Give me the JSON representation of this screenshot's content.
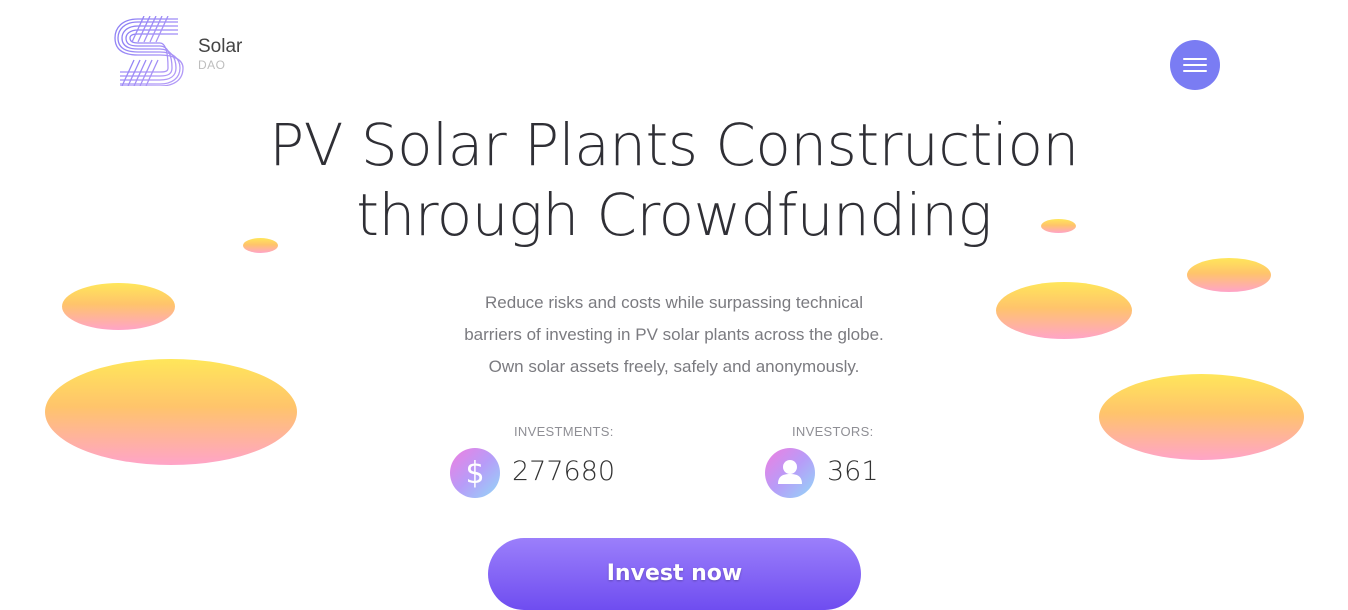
{
  "brand": {
    "name": "Solar",
    "sub": "DAO",
    "logo_icon": "solar-s-logo"
  },
  "header": {
    "menu_icon": "hamburger-menu-icon"
  },
  "hero": {
    "title_lines": [
      "PV Solar Plants Construction",
      "through Crowdfunding"
    ],
    "subtitle_lines": [
      "Reduce risks and costs while surpassing technical",
      "barriers of investing in PV solar plants across the globe.",
      "Own solar assets freely, safely and anonymously."
    ]
  },
  "stats": {
    "investments": {
      "label": "INVESTMENTS:",
      "value": "277680",
      "icon": "dollar-icon"
    },
    "investors": {
      "label": "INVESTORS:",
      "value": "361",
      "icon": "user-icon"
    }
  },
  "cta": {
    "label": "Invest now"
  },
  "colors": {
    "accent": "#7a7cf3",
    "button_top": "#9b7ffb",
    "button_bottom": "#6f4df0",
    "blob_top": "#ffe65a",
    "blob_bottom": "#ffa4c8"
  }
}
